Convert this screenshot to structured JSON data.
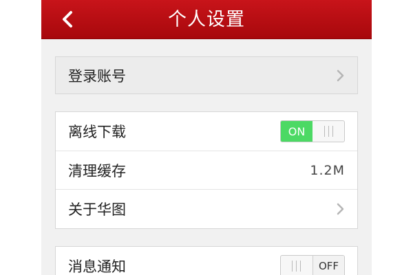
{
  "header": {
    "title": "个人设置",
    "back_icon": "chevron-left-icon"
  },
  "account_group": {
    "login_label": "登录账号"
  },
  "settings_group": {
    "offline_label": "离线下载",
    "offline_toggle_text": "ON",
    "cache_label": "清理缓存",
    "cache_value": "1.2M",
    "about_label": "关于华图"
  },
  "notify_group": {
    "notify_label": "消息通知",
    "notify_toggle_text": "OFF"
  },
  "colors": {
    "header_red": "#b40d12",
    "toggle_green": "#4cd964"
  }
}
